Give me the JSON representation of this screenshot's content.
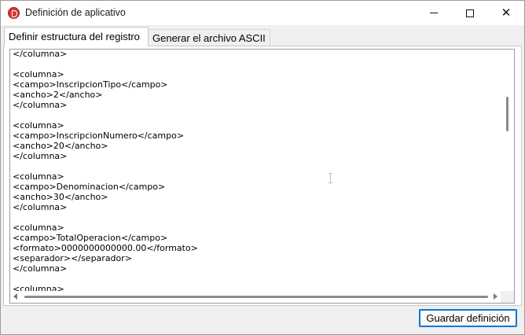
{
  "window": {
    "title": "Definición de aplicativo",
    "controls": {
      "minimize": "minimize",
      "maximize": "maximize",
      "close": "✕"
    }
  },
  "tabs": [
    {
      "label": "Definir estructura del registro",
      "selected": true
    },
    {
      "label": "Generar el archivo ASCII",
      "selected": false
    }
  ],
  "editor": {
    "lines": [
      "</columna>",
      "",
      "<columna>",
      "<campo>InscripcionTipo</campo>",
      "<ancho>2</ancho>",
      "</columna>",
      "",
      "<columna>",
      "<campo>InscripcionNumero</campo>",
      "<ancho>20</ancho>",
      "</columna>",
      "",
      "<columna>",
      "<campo>Denominacion</campo>",
      "<ancho>30</ancho>",
      "</columna>",
      "",
      "<columna>",
      "<campo>TotalOperacion</campo>",
      "<formato>0000000000000.00</formato>",
      "<separador></separador>",
      "</columna>",
      "",
      "<columna>"
    ]
  },
  "footer": {
    "save_label": "Guardar definición"
  },
  "colors": {
    "accent": "#0078d4",
    "app_icon": "#d23a3a"
  }
}
